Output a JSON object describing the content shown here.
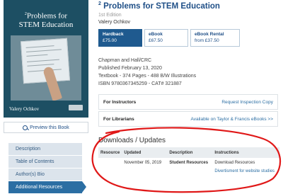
{
  "book": {
    "cover": {
      "title_sup": "2",
      "title_line1": "Problems for",
      "title_line2": "STEM Education",
      "author": "Valery Ochkov"
    },
    "title_sup": "2",
    "title": "Problems for STEM Education",
    "edition": "1st Edition",
    "author": "Valery Ochkov"
  },
  "preview_label": "Preview this Book",
  "formats": [
    {
      "name": "Hardback",
      "price": "£75.00"
    },
    {
      "name": "eBook",
      "price": "£67.50"
    },
    {
      "name": "eBook Rental",
      "price": "from £37.50"
    }
  ],
  "publication": {
    "publisher": "Chapman and Hall/CRC",
    "published": "Published February 13, 2020",
    "details": "Textbook - 374 Pages - 488 B/W Illustrations",
    "isbn": "ISBN 9780367345259 - CAT# 321887"
  },
  "instructors": {
    "label": "For Instructors",
    "link": "Request Inspection Copy"
  },
  "librarians": {
    "label": "For Librarians",
    "link": "Available on Taylor & Francis eBooks >>"
  },
  "downloads": {
    "heading": "Downloads / Updates",
    "headers": [
      "Resource",
      "Updated",
      "Description",
      "Instructions"
    ],
    "row": {
      "updated": "November 05, 2019",
      "description": "Student Resources",
      "instruction1": "Download Resources",
      "instruction2": "Divertisment for website studies"
    }
  },
  "side_nav": [
    {
      "label": "Description"
    },
    {
      "label": "Table of Contents"
    },
    {
      "label": "Author(s) Bio"
    },
    {
      "label": "Additional Resources"
    }
  ],
  "colors": {
    "brand": "#1f4f87",
    "selected_format": "#1f5a8f",
    "annotation": "#e01818"
  }
}
